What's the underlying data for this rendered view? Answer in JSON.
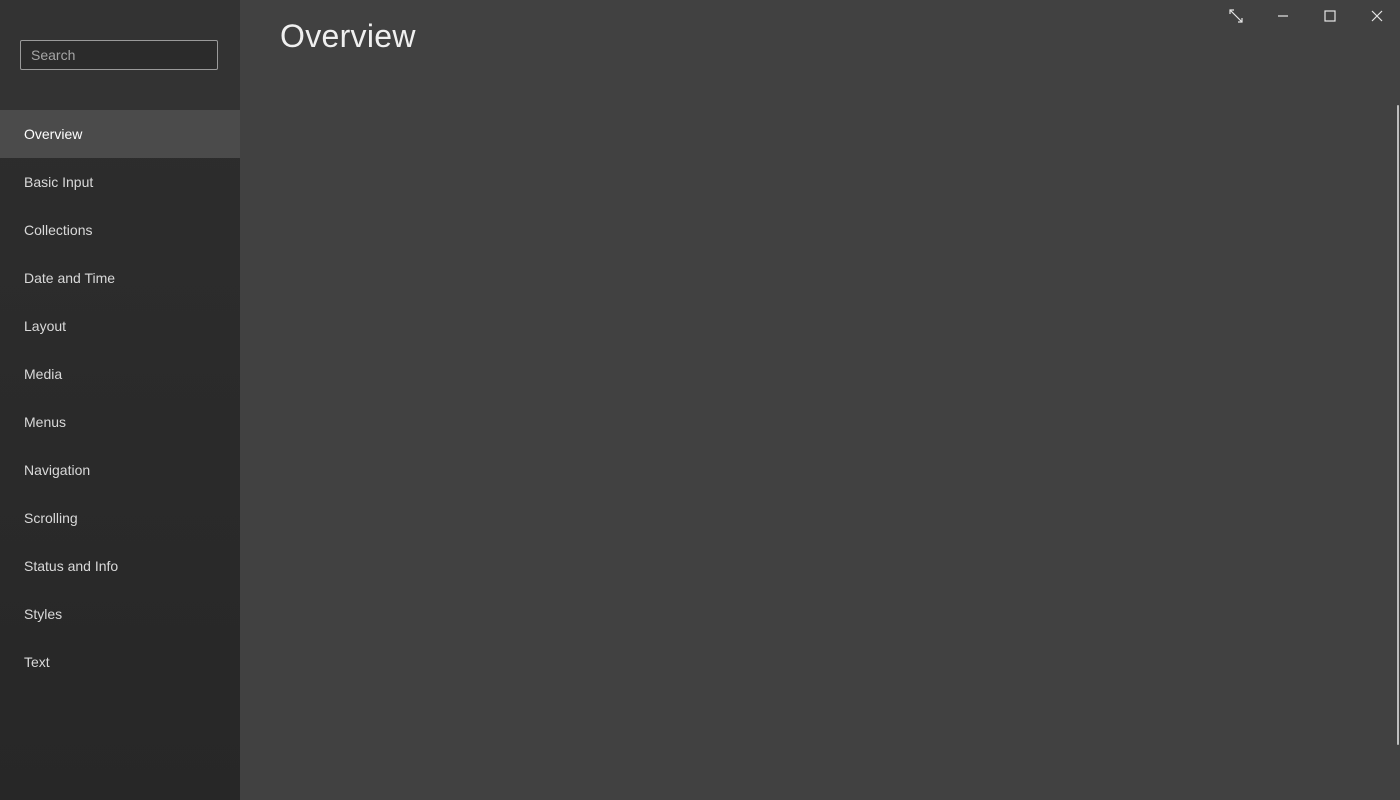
{
  "sidebar": {
    "search": {
      "placeholder": "Search",
      "value": ""
    },
    "items": [
      {
        "label": "Overview",
        "active": true
      },
      {
        "label": "Basic Input"
      },
      {
        "label": "Collections"
      },
      {
        "label": "Date and Time"
      },
      {
        "label": "Layout"
      },
      {
        "label": "Media"
      },
      {
        "label": "Menus"
      },
      {
        "label": "Navigation"
      },
      {
        "label": "Scrolling"
      },
      {
        "label": "Status and Info"
      },
      {
        "label": "Styles"
      },
      {
        "label": "Text"
      }
    ]
  },
  "main": {
    "title": "Overview"
  },
  "window_controls": {
    "icons": [
      "fullscreen-icon",
      "minimize-icon",
      "maximize-icon",
      "close-icon"
    ]
  },
  "colors": {
    "sidebar_bg": "#2b2b2b",
    "search_area_bg": "#333333",
    "active_item_bg": "#4b4b4b",
    "main_bg": "#414141",
    "text": "#e6e6e6"
  }
}
